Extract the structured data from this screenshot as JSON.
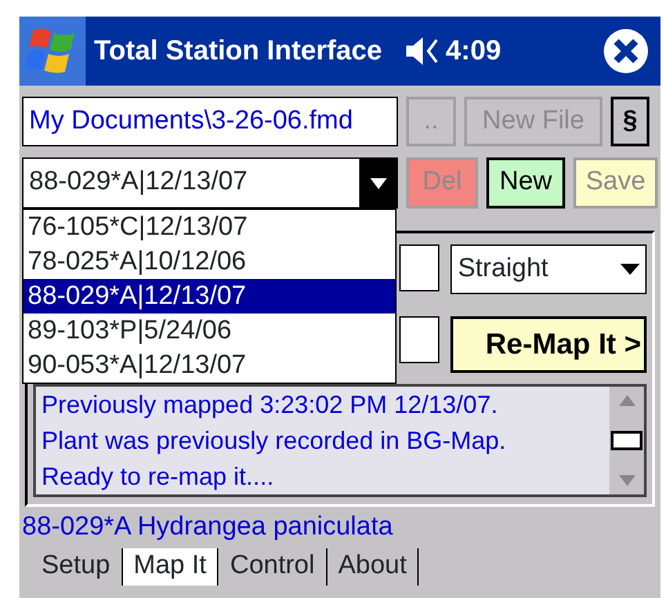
{
  "window": {
    "title": "Total Station Interface",
    "time": "4:09"
  },
  "file": {
    "path": "My Documents\\3-26-06.fmd",
    "browse_button": {
      "label": "..",
      "disabled": true
    },
    "new_file_button": {
      "label": "New File",
      "disabled": true
    },
    "section_button": {
      "label": "§",
      "disabled": false
    }
  },
  "record": {
    "value": "88-029*A|12/13/07",
    "expanded": true,
    "options": [
      {
        "label": "76-105*C|12/13/07",
        "selected": false
      },
      {
        "label": "78-025*A|10/12/06",
        "selected": false
      },
      {
        "label": "88-029*A|12/13/07",
        "selected": true
      },
      {
        "label": "89-103*P|5/24/06",
        "selected": false
      },
      {
        "label": "90-053*A|12/13/07",
        "selected": false
      }
    ]
  },
  "record_buttons": [
    {
      "label": "Del",
      "disabled": true,
      "color": "#f48480"
    },
    {
      "label": "New",
      "disabled": false,
      "color": "#c4f8c4"
    },
    {
      "label": "Save",
      "disabled": true,
      "color": "#fcfcc8"
    }
  ],
  "mode": {
    "value": "Straight"
  },
  "remap_button": {
    "label": "Re-Map It >"
  },
  "messages": [
    "Previously mapped 3:23:02 PM 12/13/07.",
    "Plant was previously recorded in BG-Map.",
    "Ready to re-map it...."
  ],
  "status": "88-029*A Hydrangea paniculata",
  "tabs": [
    {
      "label": "Setup",
      "selected": false
    },
    {
      "label": "Map It",
      "selected": true
    },
    {
      "label": "Control",
      "selected": false
    },
    {
      "label": "About",
      "selected": false
    }
  ]
}
